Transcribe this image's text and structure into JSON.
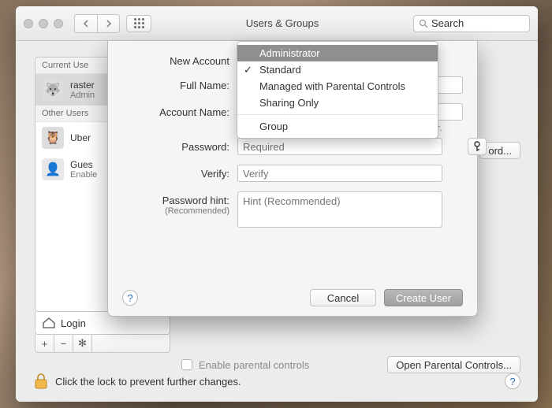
{
  "window": {
    "title": "Users & Groups",
    "search_placeholder": "Search"
  },
  "sidebar": {
    "current_label": "Current Use",
    "other_label": "Other Users",
    "users": [
      {
        "name": "raster",
        "sub": "Admin",
        "avatar": "🐺"
      },
      {
        "name": "Uber",
        "sub": "",
        "avatar": "🦉"
      },
      {
        "name": "Gues",
        "sub": "Enable",
        "avatar": "👤"
      }
    ],
    "login_label": "Login"
  },
  "toolbar": {
    "plus": "+",
    "minus": "−",
    "gear": "✻"
  },
  "right": {
    "change_password": "ord...",
    "enable_parental": "Enable parental controls",
    "open_parental": "Open Parental Controls..."
  },
  "lock": {
    "text": "Click the lock to prevent further changes."
  },
  "sheet": {
    "new_account_label": "New Account",
    "full_name_label": "Full Name:",
    "account_name_label": "Account Name:",
    "account_hint": "This will be used as the name for your home folder.",
    "password_label": "Password:",
    "password_placeholder": "Required",
    "verify_label": "Verify:",
    "verify_placeholder": "Verify",
    "hint_label": "Password hint:",
    "hint_sub": "(Recommended)",
    "hint_placeholder": "Hint (Recommended)",
    "cancel": "Cancel",
    "create": "Create User"
  },
  "dropdown": {
    "options": [
      "Administrator",
      "Standard",
      "Managed with Parental Controls",
      "Sharing Only"
    ],
    "group": "Group",
    "selected": "Standard",
    "highlighted": "Administrator"
  }
}
